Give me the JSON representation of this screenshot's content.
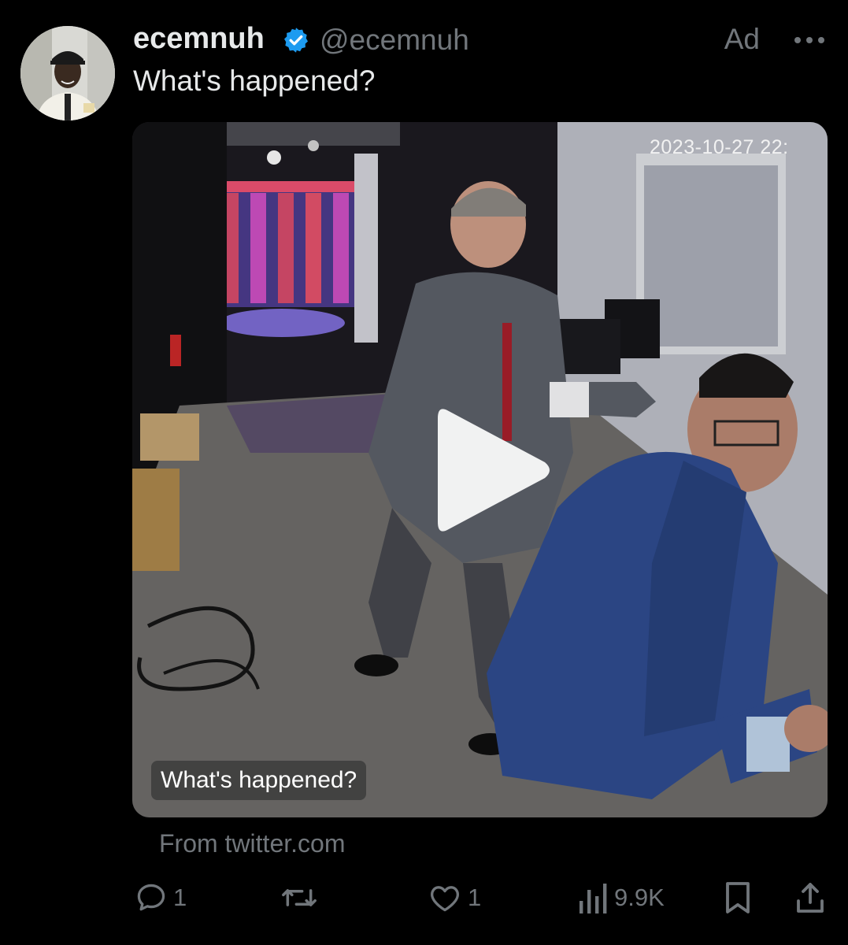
{
  "tweet": {
    "display_name": "ecemnuh",
    "handle": "@ecemnuh",
    "ad_label": "Ad",
    "text": "What's happened?",
    "verified_icon": "verified-badge-icon",
    "more_icon": "more-dots-icon"
  },
  "media": {
    "timestamp": "2023-10-27  22:",
    "caption": "What's happened?",
    "play_icon": "play-icon",
    "source": "From twitter.com"
  },
  "actions": {
    "reply_count": "1",
    "repost_count": "",
    "like_count": "1",
    "views_count": "9.9K"
  },
  "colors": {
    "background": "#000000",
    "primary_text": "#e7e9ea",
    "secondary_text": "#71767b",
    "verified_blue": "#1d9bf0"
  }
}
